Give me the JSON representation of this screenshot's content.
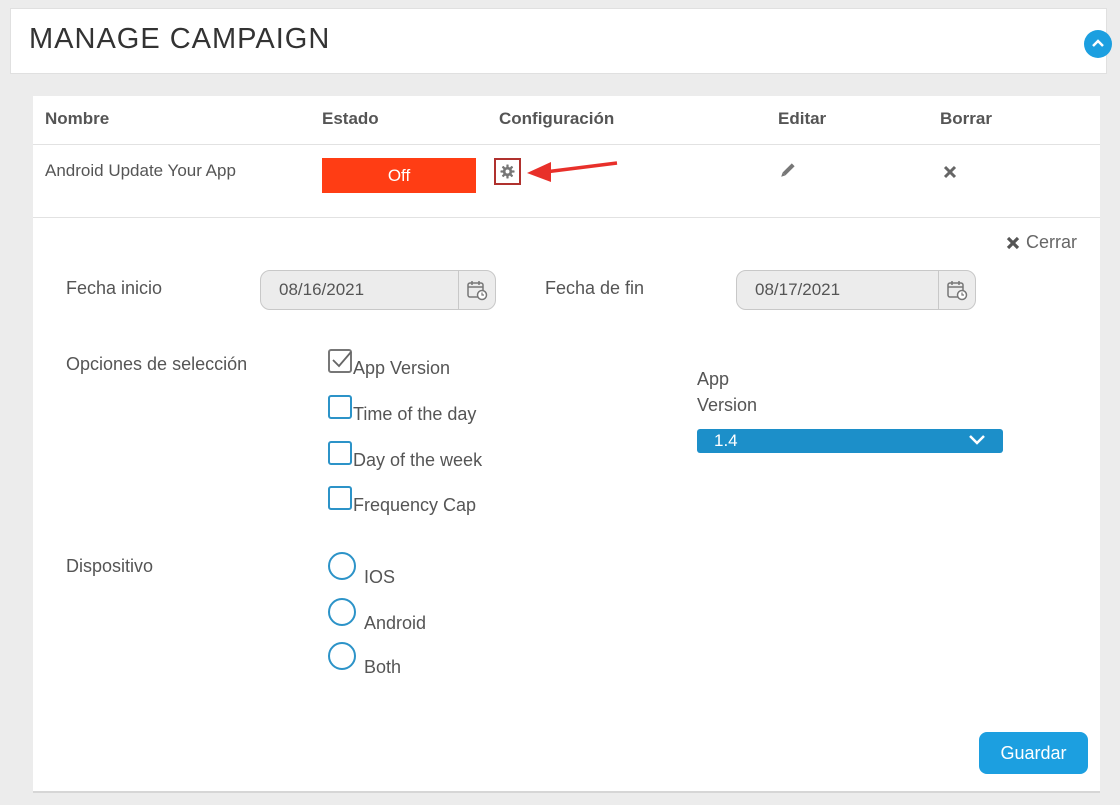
{
  "header": {
    "title": "MANAGE CAMPAIGN",
    "collapse_icon": "chevron-up-icon"
  },
  "table": {
    "columns": [
      "Nombre",
      "Estado",
      "Configuración",
      "Editar",
      "Borrar"
    ],
    "row": {
      "name": "Android Update Your App",
      "status": "Off",
      "status_color": "#ff3d14",
      "config_icon": "gear-icon",
      "edit_icon": "pencil-icon",
      "delete_icon": "close-icon"
    }
  },
  "config_panel": {
    "close_label": "Cerrar",
    "start_date": {
      "label": "Fecha inicio",
      "value": "08/16/2021"
    },
    "end_date": {
      "label": "Fecha de fin",
      "value": "08/17/2021"
    },
    "selection": {
      "label": "Opciones de selección",
      "options": [
        {
          "label": "App Version",
          "checked": true
        },
        {
          "label": "Time of the day",
          "checked": false
        },
        {
          "label": "Day of the week",
          "checked": false
        },
        {
          "label": "Frequency Cap",
          "checked": false
        }
      ]
    },
    "app_version": {
      "label_line1": "App",
      "label_line2": "Version",
      "value": "1.4"
    },
    "device": {
      "label": "Dispositivo",
      "options": [
        "IOS",
        "Android",
        "Both"
      ]
    },
    "save_label": "Guardar"
  },
  "colors": {
    "accent": "#1c9fe0",
    "select_bg": "#1c8fc9",
    "annotation": "#e8302a"
  }
}
